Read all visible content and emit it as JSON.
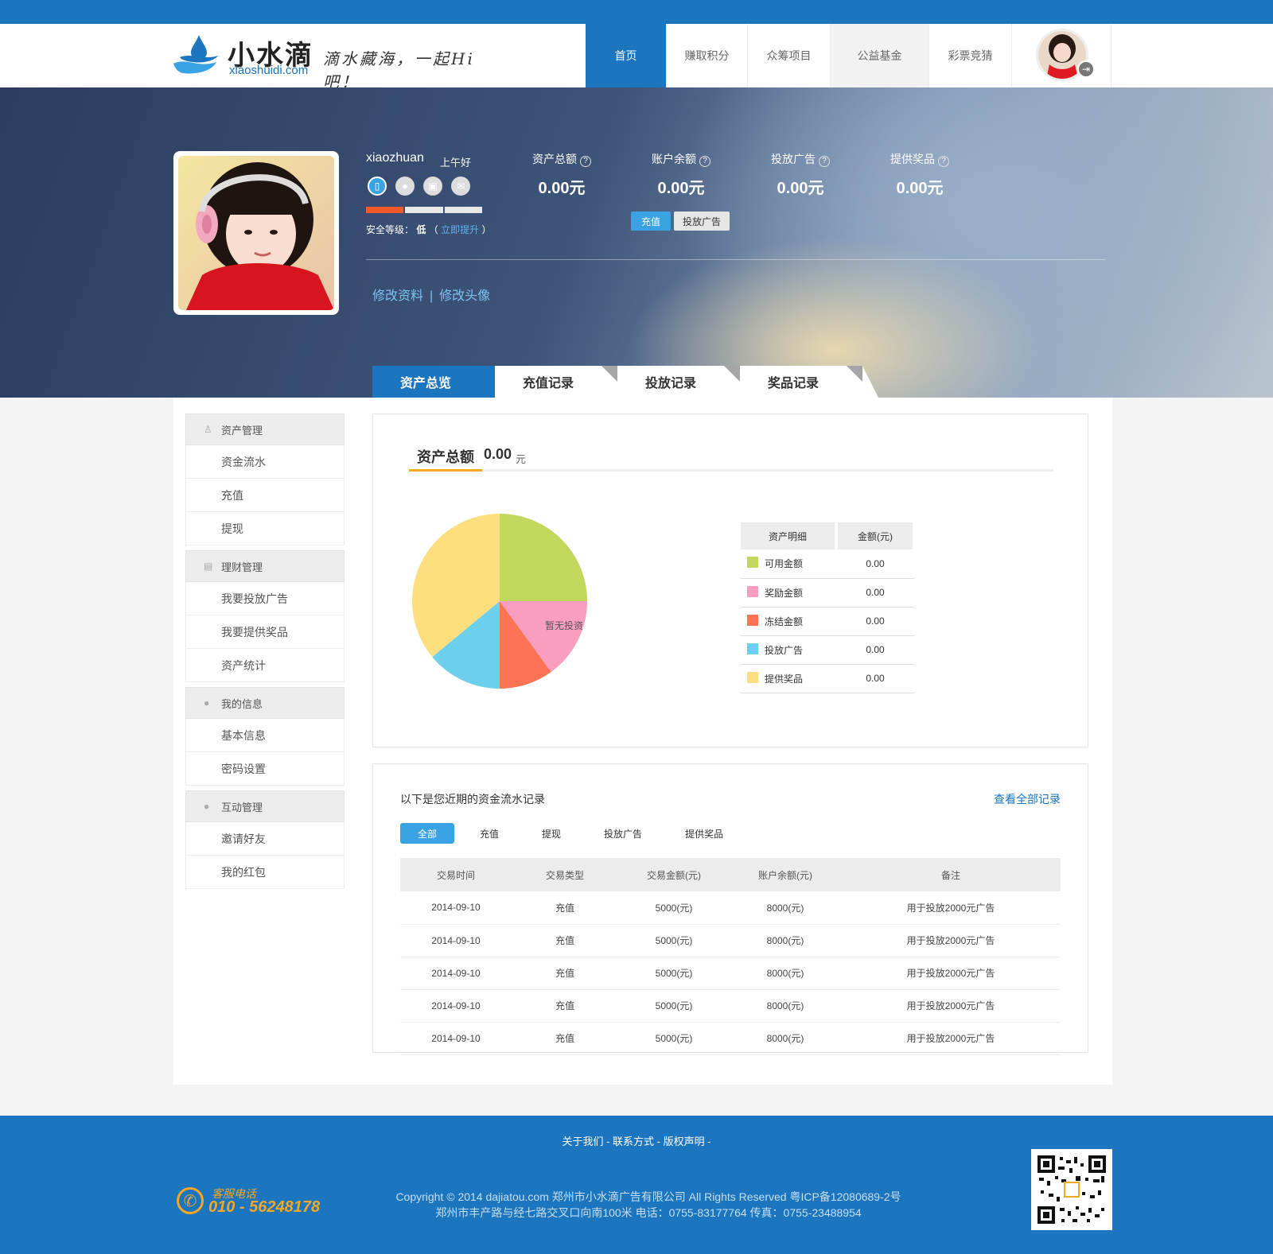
{
  "header": {
    "logo_cn": "小水滴",
    "logo_en": "xiaoshuidi.com",
    "slogan": "滴水藏海，一起Hi吧！",
    "nav": [
      {
        "label": "首页",
        "active": true
      },
      {
        "label": "赚取积分",
        "active": false
      },
      {
        "label": "众筹项目",
        "active": false
      },
      {
        "label": "公益基金",
        "active": false
      },
      {
        "label": "彩票竞猜",
        "active": false
      }
    ]
  },
  "profile": {
    "username": "xiaozhuan",
    "greeting": "上午好",
    "security_label": "安全等级：",
    "security_value": "低",
    "security_paren_open": "（",
    "security_upgrade": "立即提升",
    "security_paren_close": "）",
    "security_level_filled": 1,
    "security_level_total": 3,
    "edit_info": "修改资料",
    "edit_sep": "|",
    "edit_avatar": "修改头像",
    "stats": [
      {
        "label": "资产总额",
        "value": "0.00元"
      },
      {
        "label": "账户余额",
        "value": "0.00元"
      },
      {
        "label": "投放广告",
        "value": "0.00元"
      },
      {
        "label": "提供奖品",
        "value": "0.00元"
      }
    ],
    "help_glyph": "?",
    "recharge_button": "充值",
    "advert_button": "投放广告"
  },
  "tabs": [
    {
      "label": "资产总览",
      "active": true
    },
    {
      "label": "充值记录",
      "active": false
    },
    {
      "label": "投放记录",
      "active": false
    },
    {
      "label": "奖品记录",
      "active": false
    }
  ],
  "sidebar": {
    "groups": [
      {
        "title": "资产管理",
        "icon": "money-bag-icon",
        "items": [
          "资金流水",
          "充值",
          "提现"
        ]
      },
      {
        "title": "理财管理",
        "icon": "document-icon",
        "items": [
          "我要投放广告",
          "我要提供奖品",
          "资产统计"
        ]
      },
      {
        "title": "我的信息",
        "icon": "user-icon",
        "items": [
          "基本信息",
          "密码设置"
        ]
      },
      {
        "title": "互动管理",
        "icon": "user-icon",
        "items": [
          "邀请好友",
          "我的红包"
        ]
      }
    ]
  },
  "overview": {
    "title": "资产总额",
    "amount": "0.00",
    "unit": "元",
    "pie_label": "暂无投资",
    "legend_headers": [
      "资产明细",
      "金额(元)"
    ],
    "legend": [
      {
        "name": "可用金额",
        "value": "0.00",
        "color": "#c2d85d"
      },
      {
        "name": "奖励金额",
        "value": "0.00",
        "color": "#f99dc1"
      },
      {
        "name": "冻结金额",
        "value": "0.00",
        "color": "#fe7354"
      },
      {
        "name": "投放广告",
        "value": "0.00",
        "color": "#6cd0ec"
      },
      {
        "name": "提供奖品",
        "value": "0.00",
        "color": "#fede7e"
      }
    ]
  },
  "chart_data": {
    "type": "pie",
    "labels": [
      "可用金额",
      "奖励金额",
      "冻结金额",
      "投放广告",
      "提供奖品"
    ],
    "values": [
      25,
      15,
      10,
      14,
      36
    ],
    "colors": [
      "#c2d85d",
      "#f99dc1",
      "#fe7354",
      "#6cd0ec",
      "#fede7e"
    ],
    "annotation": "暂无投资"
  },
  "records": {
    "title": "以下是您近期的资金流水记录",
    "view_all": "查看全部记录",
    "filters": [
      {
        "label": "全部",
        "active": true
      },
      {
        "label": "充值",
        "active": false
      },
      {
        "label": "提现",
        "active": false
      },
      {
        "label": "投放广告",
        "active": false
      },
      {
        "label": "提供奖品",
        "active": false
      }
    ],
    "headers": [
      "交易时间",
      "交易类型",
      "交易金额(元)",
      "账户余额(元)",
      "备注"
    ],
    "rows": [
      [
        "2014-09-10",
        "充值",
        "5000(元)",
        "8000(元)",
        "用于投放2000元广告"
      ],
      [
        "2014-09-10",
        "充值",
        "5000(元)",
        "8000(元)",
        "用于投放2000元广告"
      ],
      [
        "2014-09-10",
        "充值",
        "5000(元)",
        "8000(元)",
        "用于投放2000元广告"
      ],
      [
        "2014-09-10",
        "充值",
        "5000(元)",
        "8000(元)",
        "用于投放2000元广告"
      ],
      [
        "2014-09-10",
        "充值",
        "5000(元)",
        "8000(元)",
        "用于投放2000元广告"
      ]
    ]
  },
  "footer": {
    "links": "关于我们 - 联系方式 - 版权声明 -",
    "phone_label": "客服电话",
    "phone": "010 - 56248178",
    "copyright": "Copyright © 2014 dajiatou.com 郑州市小水滴广告有限公司 All Rights Reserved 粤ICP备12080689-2号",
    "address": "郑州市丰产路与经七路交叉口向南100米 电话：0755-83177764 传真：0755-23488954"
  }
}
